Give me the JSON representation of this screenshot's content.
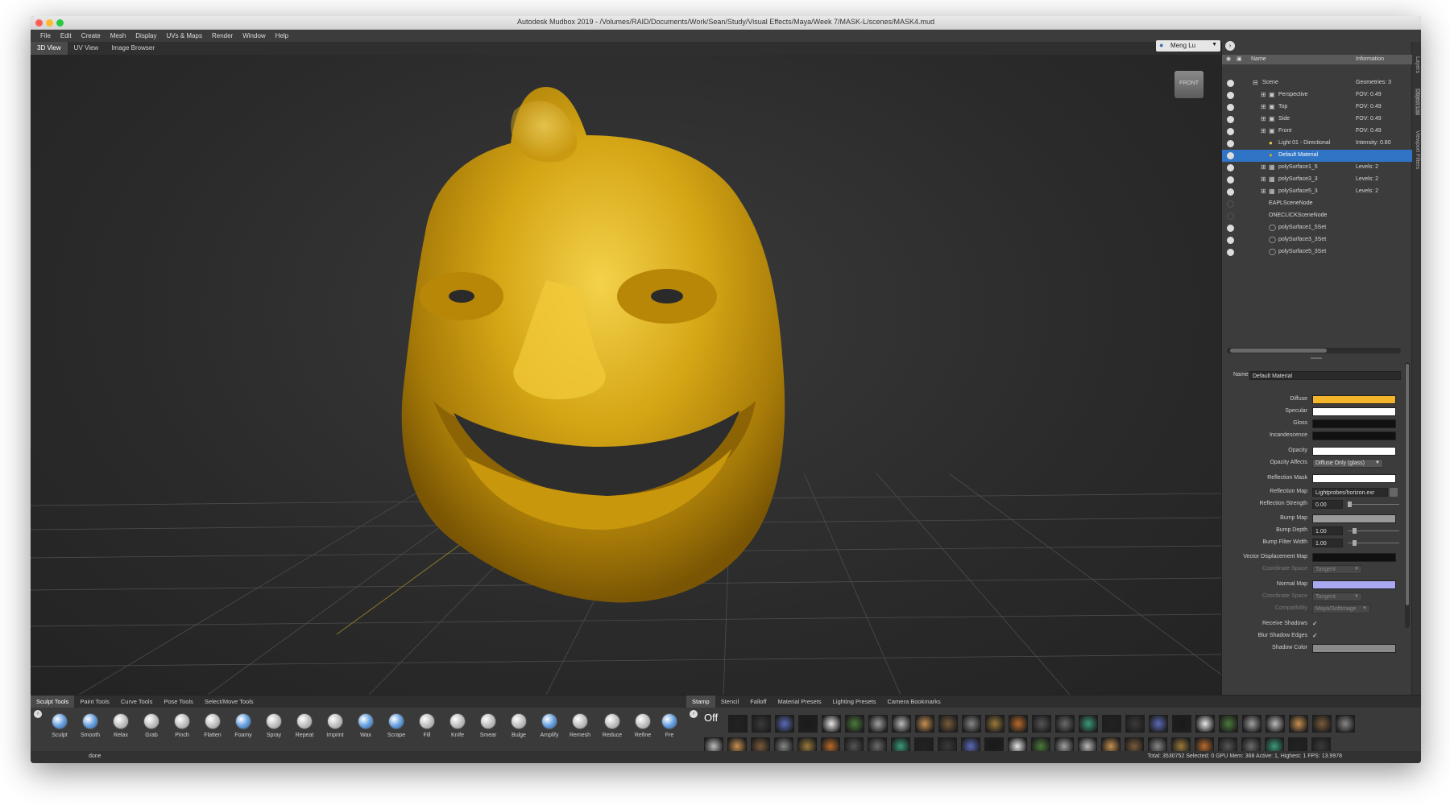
{
  "window": {
    "title": "Autodesk Mudbox 2019 - /Volumes/RAID/Documents/Work/Sean/Study/Visual Effects/Maya/Week 7/MASK-L/scenes/MASK4.mud"
  },
  "menu": [
    "File",
    "Edit",
    "Create",
    "Mesh",
    "Display",
    "UVs & Maps",
    "Render",
    "Window",
    "Help"
  ],
  "view_tabs": [
    "3D View",
    "UV View",
    "Image Browser"
  ],
  "user": "Meng Lu",
  "viewcube_label": "FRONT",
  "right_strip_tabs": [
    "Layers",
    "Object List",
    "Viewport Filters"
  ],
  "object_list": {
    "headers": {
      "name": "Name",
      "info": "Information"
    },
    "rows": [
      {
        "name": "Scene",
        "info": "Geometries: 3"
      },
      {
        "name": "Perspective",
        "info": "FOV: 0.49"
      },
      {
        "name": "Top",
        "info": "FOV: 0.49"
      },
      {
        "name": "Side",
        "info": "FOV: 0.49"
      },
      {
        "name": "Front",
        "info": "FOV: 0.49"
      },
      {
        "name": "Light 01 - Directional",
        "info": "Intensity: 0.80"
      },
      {
        "name": "Default Material",
        "info": ""
      },
      {
        "name": "polySurface1_5",
        "info": "Levels: 2"
      },
      {
        "name": "polySurface3_3",
        "info": "Levels: 2"
      },
      {
        "name": "polySurface5_3",
        "info": "Levels: 2"
      },
      {
        "name": "EAPLSceneNode",
        "info": ""
      },
      {
        "name": "ONECLICKSceneNode",
        "info": ""
      },
      {
        "name": "polySurface1_5Set",
        "info": ""
      },
      {
        "name": "polySurface3_3Set",
        "info": ""
      },
      {
        "name": "polySurface5_3Set",
        "info": ""
      }
    ]
  },
  "properties": {
    "name_label": "Name",
    "name_value": "Default Material",
    "diffuse": "Diffuse",
    "specular": "Specular",
    "gloss": "Gloss",
    "incandescence": "Incandescence",
    "opacity": "Opacity",
    "opacity_affects": "Opacity Affects",
    "opacity_affects_value": "Diffuse Only (glass)",
    "reflection_mask": "Reflection Mask",
    "reflection_map": "Reflection Map",
    "reflection_map_value": "Lightprobes/horizon.exr",
    "reflection_strength": "Reflection Strength",
    "reflection_strength_value": "0.00",
    "bump_map": "Bump Map",
    "bump_depth": "Bump Depth",
    "bump_depth_value": "1.00",
    "bump_filter_width": "Bump Filter Width",
    "bump_filter_width_value": "1.00",
    "vector_displacement_map": "Vector Displacement Map",
    "coordinate_space": "Coordinate Space",
    "coordinate_space_value": "Tangent",
    "normal_map": "Normal Map",
    "compatibility": "Compatibility",
    "compatibility_value": "Maya/Softimage",
    "receive_shadows": "Receive Shadows",
    "blur_shadow_edges": "Blur Shadow Edges",
    "shadow_color": "Shadow Color",
    "check": "✓",
    "colors": {
      "diffuse": "#f5b52a",
      "specular": "#ffffff",
      "gloss": "#111111",
      "incandescence": "#111111",
      "opacity": "#ffffff",
      "reflection_mask": "#ffffff",
      "bump_map": "#9a9a9a",
      "vector_displacement_map": "#111111",
      "normal_map": "#a9a9f2",
      "shadow_color": "#8a8a8a"
    }
  },
  "shelf": {
    "tool_tabs": [
      "Sculpt Tools",
      "Paint Tools",
      "Curve Tools",
      "Pose Tools",
      "Select/Move Tools"
    ],
    "stamp_tabs": [
      "Stamp",
      "Stencil",
      "Falloff",
      "Material Presets",
      "Lighting Presets",
      "Camera Bookmarks"
    ],
    "tools": [
      "Sculpt",
      "Smooth",
      "Relax",
      "Grab",
      "Pinch",
      "Flatten",
      "Foamy",
      "Spray",
      "Repeat",
      "Imprint",
      "Wax",
      "Scrape",
      "Fill",
      "Knife",
      "Smear",
      "Bulge",
      "Amplify",
      "Remesh",
      "Reduce",
      "Refine",
      "Fre"
    ],
    "stamp_off": "Off"
  },
  "status": {
    "left": "done",
    "right": "Total: 3530752  Selected: 0 GPU Mem: 368  Active: 1, Highest: 1  FPS: 13.9978"
  },
  "accent": {
    "selection": "#2f74c5",
    "mask_gold": "#c99a12"
  }
}
